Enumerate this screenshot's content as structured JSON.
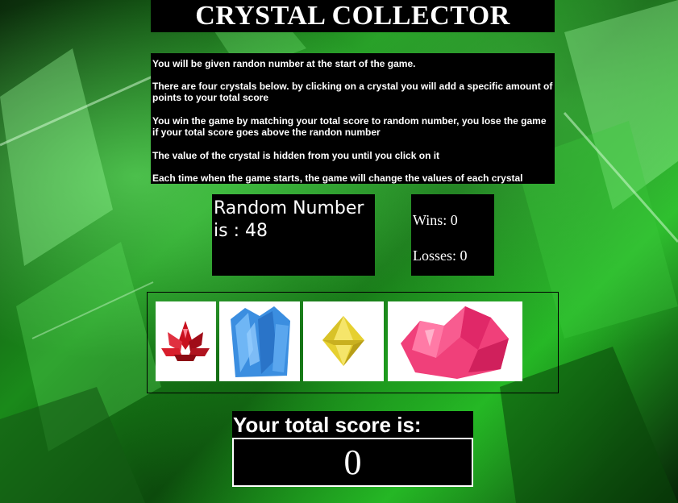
{
  "header": {
    "title": "CRYSTAL COLLECTOR"
  },
  "instructions": [
    "You will be given randon number at the start of the game.",
    "There are four crystals below. by clicking on a crystal you will add a specific amount of points to your total score",
    "You win the game by matching your total score to random number, you lose the game if your total score goes above the randon number",
    "The value of the crystal is hidden from you until you click on it",
    "Each time when the game starts, the game will change the values of each crystal"
  ],
  "random": {
    "label": "Random Number is : 48"
  },
  "stats": {
    "wins": "Wins: 0",
    "losses": "Losses: 0"
  },
  "crystals": [
    {
      "name": "red-lotus-crystal",
      "color": "#d0202a"
    },
    {
      "name": "blue-crystal-cluster",
      "color": "#3a8fe0"
    },
    {
      "name": "yellow-bicone-crystal",
      "color": "#e8d23a"
    },
    {
      "name": "pink-crystal-cluster",
      "color": "#f0407a"
    }
  ],
  "score": {
    "label": "Your total score is:",
    "value": "0"
  }
}
